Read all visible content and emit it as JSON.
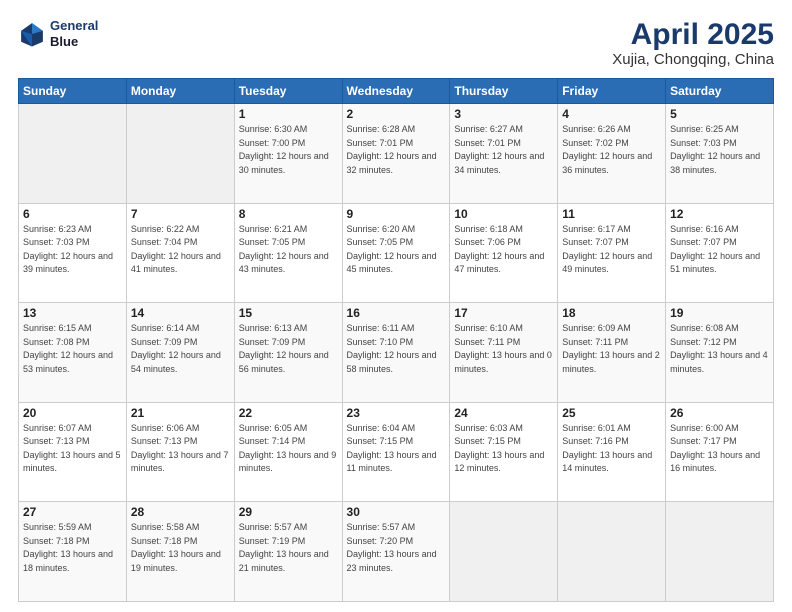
{
  "header": {
    "logo_line1": "General",
    "logo_line2": "Blue",
    "title": "April 2025",
    "subtitle": "Xujia, Chongqing, China"
  },
  "weekdays": [
    "Sunday",
    "Monday",
    "Tuesday",
    "Wednesday",
    "Thursday",
    "Friday",
    "Saturday"
  ],
  "weeks": [
    [
      {
        "day": "",
        "sunrise": "",
        "sunset": "",
        "daylight": ""
      },
      {
        "day": "",
        "sunrise": "",
        "sunset": "",
        "daylight": ""
      },
      {
        "day": "1",
        "sunrise": "Sunrise: 6:30 AM",
        "sunset": "Sunset: 7:00 PM",
        "daylight": "Daylight: 12 hours and 30 minutes."
      },
      {
        "day": "2",
        "sunrise": "Sunrise: 6:28 AM",
        "sunset": "Sunset: 7:01 PM",
        "daylight": "Daylight: 12 hours and 32 minutes."
      },
      {
        "day": "3",
        "sunrise": "Sunrise: 6:27 AM",
        "sunset": "Sunset: 7:01 PM",
        "daylight": "Daylight: 12 hours and 34 minutes."
      },
      {
        "day": "4",
        "sunrise": "Sunrise: 6:26 AM",
        "sunset": "Sunset: 7:02 PM",
        "daylight": "Daylight: 12 hours and 36 minutes."
      },
      {
        "day": "5",
        "sunrise": "Sunrise: 6:25 AM",
        "sunset": "Sunset: 7:03 PM",
        "daylight": "Daylight: 12 hours and 38 minutes."
      }
    ],
    [
      {
        "day": "6",
        "sunrise": "Sunrise: 6:23 AM",
        "sunset": "Sunset: 7:03 PM",
        "daylight": "Daylight: 12 hours and 39 minutes."
      },
      {
        "day": "7",
        "sunrise": "Sunrise: 6:22 AM",
        "sunset": "Sunset: 7:04 PM",
        "daylight": "Daylight: 12 hours and 41 minutes."
      },
      {
        "day": "8",
        "sunrise": "Sunrise: 6:21 AM",
        "sunset": "Sunset: 7:05 PM",
        "daylight": "Daylight: 12 hours and 43 minutes."
      },
      {
        "day": "9",
        "sunrise": "Sunrise: 6:20 AM",
        "sunset": "Sunset: 7:05 PM",
        "daylight": "Daylight: 12 hours and 45 minutes."
      },
      {
        "day": "10",
        "sunrise": "Sunrise: 6:18 AM",
        "sunset": "Sunset: 7:06 PM",
        "daylight": "Daylight: 12 hours and 47 minutes."
      },
      {
        "day": "11",
        "sunrise": "Sunrise: 6:17 AM",
        "sunset": "Sunset: 7:07 PM",
        "daylight": "Daylight: 12 hours and 49 minutes."
      },
      {
        "day": "12",
        "sunrise": "Sunrise: 6:16 AM",
        "sunset": "Sunset: 7:07 PM",
        "daylight": "Daylight: 12 hours and 51 minutes."
      }
    ],
    [
      {
        "day": "13",
        "sunrise": "Sunrise: 6:15 AM",
        "sunset": "Sunset: 7:08 PM",
        "daylight": "Daylight: 12 hours and 53 minutes."
      },
      {
        "day": "14",
        "sunrise": "Sunrise: 6:14 AM",
        "sunset": "Sunset: 7:09 PM",
        "daylight": "Daylight: 12 hours and 54 minutes."
      },
      {
        "day": "15",
        "sunrise": "Sunrise: 6:13 AM",
        "sunset": "Sunset: 7:09 PM",
        "daylight": "Daylight: 12 hours and 56 minutes."
      },
      {
        "day": "16",
        "sunrise": "Sunrise: 6:11 AM",
        "sunset": "Sunset: 7:10 PM",
        "daylight": "Daylight: 12 hours and 58 minutes."
      },
      {
        "day": "17",
        "sunrise": "Sunrise: 6:10 AM",
        "sunset": "Sunset: 7:11 PM",
        "daylight": "Daylight: 13 hours and 0 minutes."
      },
      {
        "day": "18",
        "sunrise": "Sunrise: 6:09 AM",
        "sunset": "Sunset: 7:11 PM",
        "daylight": "Daylight: 13 hours and 2 minutes."
      },
      {
        "day": "19",
        "sunrise": "Sunrise: 6:08 AM",
        "sunset": "Sunset: 7:12 PM",
        "daylight": "Daylight: 13 hours and 4 minutes."
      }
    ],
    [
      {
        "day": "20",
        "sunrise": "Sunrise: 6:07 AM",
        "sunset": "Sunset: 7:13 PM",
        "daylight": "Daylight: 13 hours and 5 minutes."
      },
      {
        "day": "21",
        "sunrise": "Sunrise: 6:06 AM",
        "sunset": "Sunset: 7:13 PM",
        "daylight": "Daylight: 13 hours and 7 minutes."
      },
      {
        "day": "22",
        "sunrise": "Sunrise: 6:05 AM",
        "sunset": "Sunset: 7:14 PM",
        "daylight": "Daylight: 13 hours and 9 minutes."
      },
      {
        "day": "23",
        "sunrise": "Sunrise: 6:04 AM",
        "sunset": "Sunset: 7:15 PM",
        "daylight": "Daylight: 13 hours and 11 minutes."
      },
      {
        "day": "24",
        "sunrise": "Sunrise: 6:03 AM",
        "sunset": "Sunset: 7:15 PM",
        "daylight": "Daylight: 13 hours and 12 minutes."
      },
      {
        "day": "25",
        "sunrise": "Sunrise: 6:01 AM",
        "sunset": "Sunset: 7:16 PM",
        "daylight": "Daylight: 13 hours and 14 minutes."
      },
      {
        "day": "26",
        "sunrise": "Sunrise: 6:00 AM",
        "sunset": "Sunset: 7:17 PM",
        "daylight": "Daylight: 13 hours and 16 minutes."
      }
    ],
    [
      {
        "day": "27",
        "sunrise": "Sunrise: 5:59 AM",
        "sunset": "Sunset: 7:18 PM",
        "daylight": "Daylight: 13 hours and 18 minutes."
      },
      {
        "day": "28",
        "sunrise": "Sunrise: 5:58 AM",
        "sunset": "Sunset: 7:18 PM",
        "daylight": "Daylight: 13 hours and 19 minutes."
      },
      {
        "day": "29",
        "sunrise": "Sunrise: 5:57 AM",
        "sunset": "Sunset: 7:19 PM",
        "daylight": "Daylight: 13 hours and 21 minutes."
      },
      {
        "day": "30",
        "sunrise": "Sunrise: 5:57 AM",
        "sunset": "Sunset: 7:20 PM",
        "daylight": "Daylight: 13 hours and 23 minutes."
      },
      {
        "day": "",
        "sunrise": "",
        "sunset": "",
        "daylight": ""
      },
      {
        "day": "",
        "sunrise": "",
        "sunset": "",
        "daylight": ""
      },
      {
        "day": "",
        "sunrise": "",
        "sunset": "",
        "daylight": ""
      }
    ]
  ]
}
